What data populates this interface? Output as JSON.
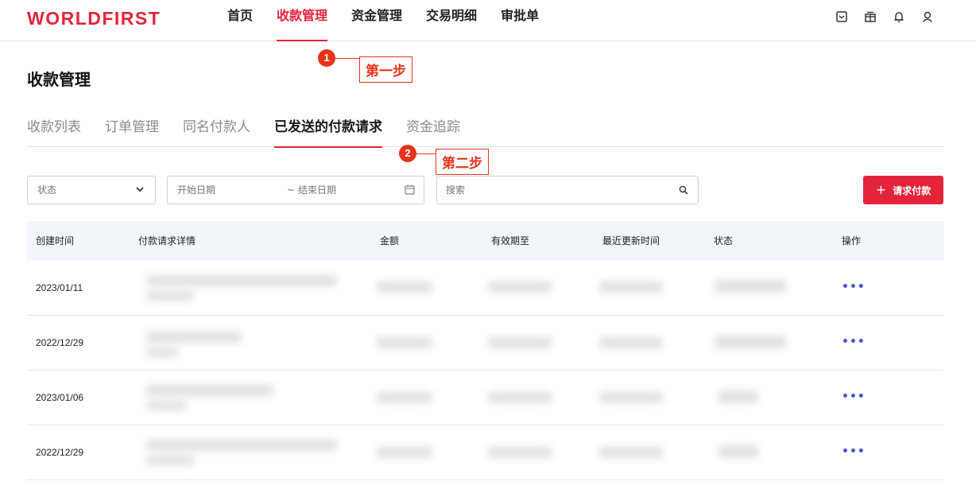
{
  "brand": {
    "logo": "WORLDFIRST",
    "accent": "#e3243b"
  },
  "nav": {
    "items": [
      {
        "label": "首页",
        "active": false
      },
      {
        "label": "收款管理",
        "active": true
      },
      {
        "label": "资金管理",
        "active": false
      },
      {
        "label": "交易明细",
        "active": false
      },
      {
        "label": "审批单",
        "active": false
      }
    ],
    "icons": [
      "wallet-icon",
      "gift-icon",
      "bell-icon",
      "user-icon"
    ]
  },
  "page": {
    "title": "收款管理"
  },
  "annotations": [
    {
      "number": "1",
      "label": "第一步"
    },
    {
      "number": "2",
      "label": "第二步"
    }
  ],
  "subtabs": [
    {
      "label": "收款列表",
      "active": false
    },
    {
      "label": "订单管理",
      "active": false
    },
    {
      "label": "同名付款人",
      "active": false
    },
    {
      "label": "已发送的付款请求",
      "active": true
    },
    {
      "label": "资金追踪",
      "active": false
    }
  ],
  "filters": {
    "status_placeholder": "状态",
    "start_date_placeholder": "开始日期",
    "date_separator": "~",
    "end_date_placeholder": "结束日期",
    "search_placeholder": "搜索",
    "request_button": "请求付款"
  },
  "table": {
    "columns": [
      "创建时间",
      "付款请求详情",
      "金额",
      "有效期至",
      "最近更新时间",
      "状态",
      "操作"
    ],
    "rows": [
      {
        "created": "2023/01/11",
        "action": "•••"
      },
      {
        "created": "2022/12/29",
        "action": "•••"
      },
      {
        "created": "2023/01/06",
        "action": "•••"
      },
      {
        "created": "2022/12/29",
        "action": "•••"
      }
    ]
  }
}
